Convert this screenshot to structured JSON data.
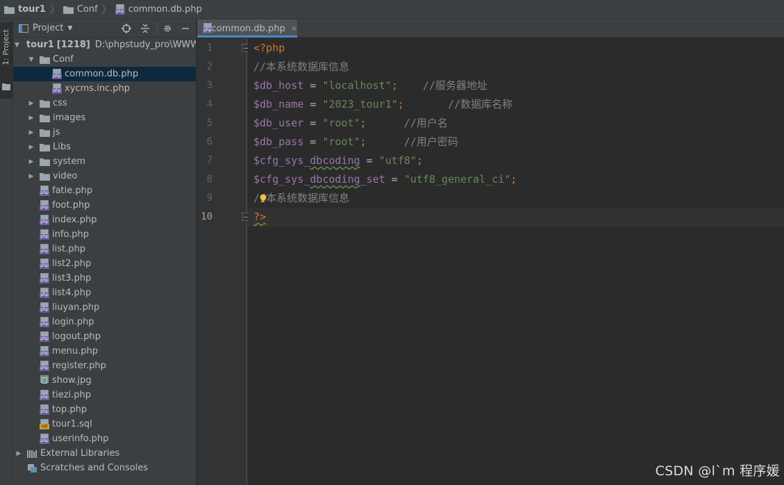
{
  "breadcrumb": {
    "items": [
      "tour1",
      "Conf",
      "common.db.php"
    ]
  },
  "left_strip": {
    "project_label": "1: Project"
  },
  "project_panel": {
    "title": "Project",
    "icons": [
      "locate-icon",
      "collapse-icon",
      "gear-icon",
      "minimize-icon"
    ]
  },
  "tree": {
    "root": {
      "name": "tour1",
      "count": "[1218]",
      "path": "D:\\phpstudy_pro\\WWW\\"
    },
    "conf": "Conf",
    "conf_children": [
      "common.db.php",
      "xycms.inc.php"
    ],
    "folders": [
      "css",
      "images",
      "js",
      "Libs",
      "system",
      "video"
    ],
    "files": [
      {
        "name": "fatie.php",
        "type": "php"
      },
      {
        "name": "foot.php",
        "type": "php"
      },
      {
        "name": "index.php",
        "type": "php"
      },
      {
        "name": "info.php",
        "type": "php"
      },
      {
        "name": "list.php",
        "type": "php"
      },
      {
        "name": "list2.php",
        "type": "php"
      },
      {
        "name": "list3.php",
        "type": "php"
      },
      {
        "name": "list4.php",
        "type": "php"
      },
      {
        "name": "liuyan.php",
        "type": "php"
      },
      {
        "name": "login.php",
        "type": "php"
      },
      {
        "name": "logout.php",
        "type": "php"
      },
      {
        "name": "menu.php",
        "type": "php"
      },
      {
        "name": "register.php",
        "type": "php"
      },
      {
        "name": "show.jpg",
        "type": "jpg"
      },
      {
        "name": "tiezi.php",
        "type": "php"
      },
      {
        "name": "top.php",
        "type": "php"
      },
      {
        "name": "tour1.sql",
        "type": "sql"
      },
      {
        "name": "userinfo.php",
        "type": "php"
      }
    ],
    "external": "External Libraries",
    "scratches": "Scratches and Consoles"
  },
  "tabs": [
    {
      "label": "common.db.php",
      "active": true
    }
  ],
  "editor": {
    "line_numbers": [
      "1",
      "2",
      "3",
      "4",
      "5",
      "6",
      "7",
      "8",
      "9",
      "10"
    ],
    "lines": [
      [
        {
          "t": "<?php",
          "c": "tag"
        }
      ],
      [
        {
          "t": "//本系统数据库信息",
          "c": "cmt"
        }
      ],
      [
        {
          "t": "$db_host",
          "c": "var"
        },
        {
          "t": " = ",
          "c": "op"
        },
        {
          "t": "\"localhost\"",
          "c": "str"
        },
        {
          "t": ";",
          "c": "semi"
        },
        {
          "t": "    //服务器地址",
          "c": "cmt"
        }
      ],
      [
        {
          "t": "$db_name",
          "c": "var"
        },
        {
          "t": " = ",
          "c": "op"
        },
        {
          "t": "\"2023_tour1\"",
          "c": "str"
        },
        {
          "t": ";",
          "c": "semi"
        },
        {
          "t": "       //数据库名称",
          "c": "cmt"
        }
      ],
      [
        {
          "t": "$db_user",
          "c": "var"
        },
        {
          "t": " = ",
          "c": "op"
        },
        {
          "t": "\"root\"",
          "c": "str"
        },
        {
          "t": ";",
          "c": "semi"
        },
        {
          "t": "      //用户名",
          "c": "cmt"
        }
      ],
      [
        {
          "t": "$db_pass",
          "c": "var"
        },
        {
          "t": " = ",
          "c": "op"
        },
        {
          "t": "\"root\"",
          "c": "str"
        },
        {
          "t": ";",
          "c": "semi"
        },
        {
          "t": "      //用户密码",
          "c": "cmt"
        }
      ],
      [
        {
          "t": "$cfg_sys_",
          "c": "var"
        },
        {
          "t": "dbcoding",
          "c": "var",
          "w": "1"
        },
        {
          "t": " = ",
          "c": "op"
        },
        {
          "t": "\"utf8\"",
          "c": "str"
        },
        {
          "t": ";",
          "c": "semi"
        }
      ],
      [
        {
          "t": "$cfg_sys_",
          "c": "var"
        },
        {
          "t": "dbcoding",
          "c": "var",
          "w": "1"
        },
        {
          "t": "_set",
          "c": "var"
        },
        {
          "t": " = ",
          "c": "op"
        },
        {
          "t": "\"utf8_general_ci\"",
          "c": "str"
        },
        {
          "t": ";",
          "c": "semi"
        }
      ],
      [
        {
          "t": "//本系统数据库信息",
          "c": "cmt"
        }
      ],
      [
        {
          "t": "?>",
          "c": "tag",
          "w": "tag"
        }
      ]
    ],
    "current_line": "10"
  },
  "watermark": "CSDN @l`m 程序媛",
  "colors": {
    "background": "#2b2b2b",
    "panel": "#3c3f41",
    "selection": "#0d293e",
    "accent": "#4a88c7",
    "keyword": "#cc7832",
    "string": "#6a8759",
    "variable": "#9876aa",
    "comment": "#808080"
  }
}
